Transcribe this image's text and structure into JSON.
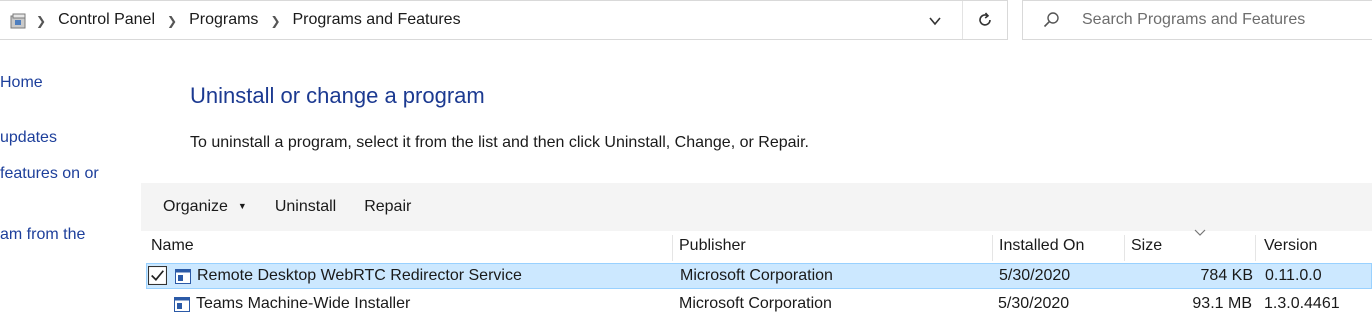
{
  "address_bar": {
    "crumbs": [
      "Control Panel",
      "Programs",
      "Programs and Features"
    ]
  },
  "search": {
    "placeholder": "Search Programs and Features"
  },
  "left_pane": {
    "links": [
      "Home",
      "updates",
      "features on or",
      "am from the"
    ]
  },
  "main": {
    "title": "Uninstall or change a program",
    "description": "To uninstall a program, select it from the list and then click Uninstall, Change, or Repair."
  },
  "toolbar": {
    "organize_label": "Organize",
    "uninstall_label": "Uninstall",
    "repair_label": "Repair"
  },
  "table": {
    "columns": [
      "Name",
      "Publisher",
      "Installed On",
      "Size",
      "Version"
    ],
    "rows": [
      {
        "name": "Remote Desktop WebRTC Redirector Service",
        "publisher": "Microsoft Corporation",
        "installed_on": "5/30/2020",
        "size": "784 KB",
        "version": "0.11.0.0",
        "selected": true
      },
      {
        "name": "Teams Machine-Wide Installer",
        "publisher": "Microsoft Corporation",
        "installed_on": "5/30/2020",
        "size": "93.1 MB",
        "version": "1.3.0.4461",
        "selected": false
      }
    ]
  },
  "colors": {
    "link": "#1d3f9b",
    "selection_bg": "#cce8ff",
    "selection_border": "#99d1ff",
    "toolbar_bg": "#f4f4f4"
  },
  "icons": [
    "control-panel-folder-icon",
    "chevron-right-icon",
    "chevron-down-icon",
    "refresh-icon",
    "search-icon",
    "checkbox-icon",
    "program-icon",
    "sort-indicator-icon"
  ]
}
